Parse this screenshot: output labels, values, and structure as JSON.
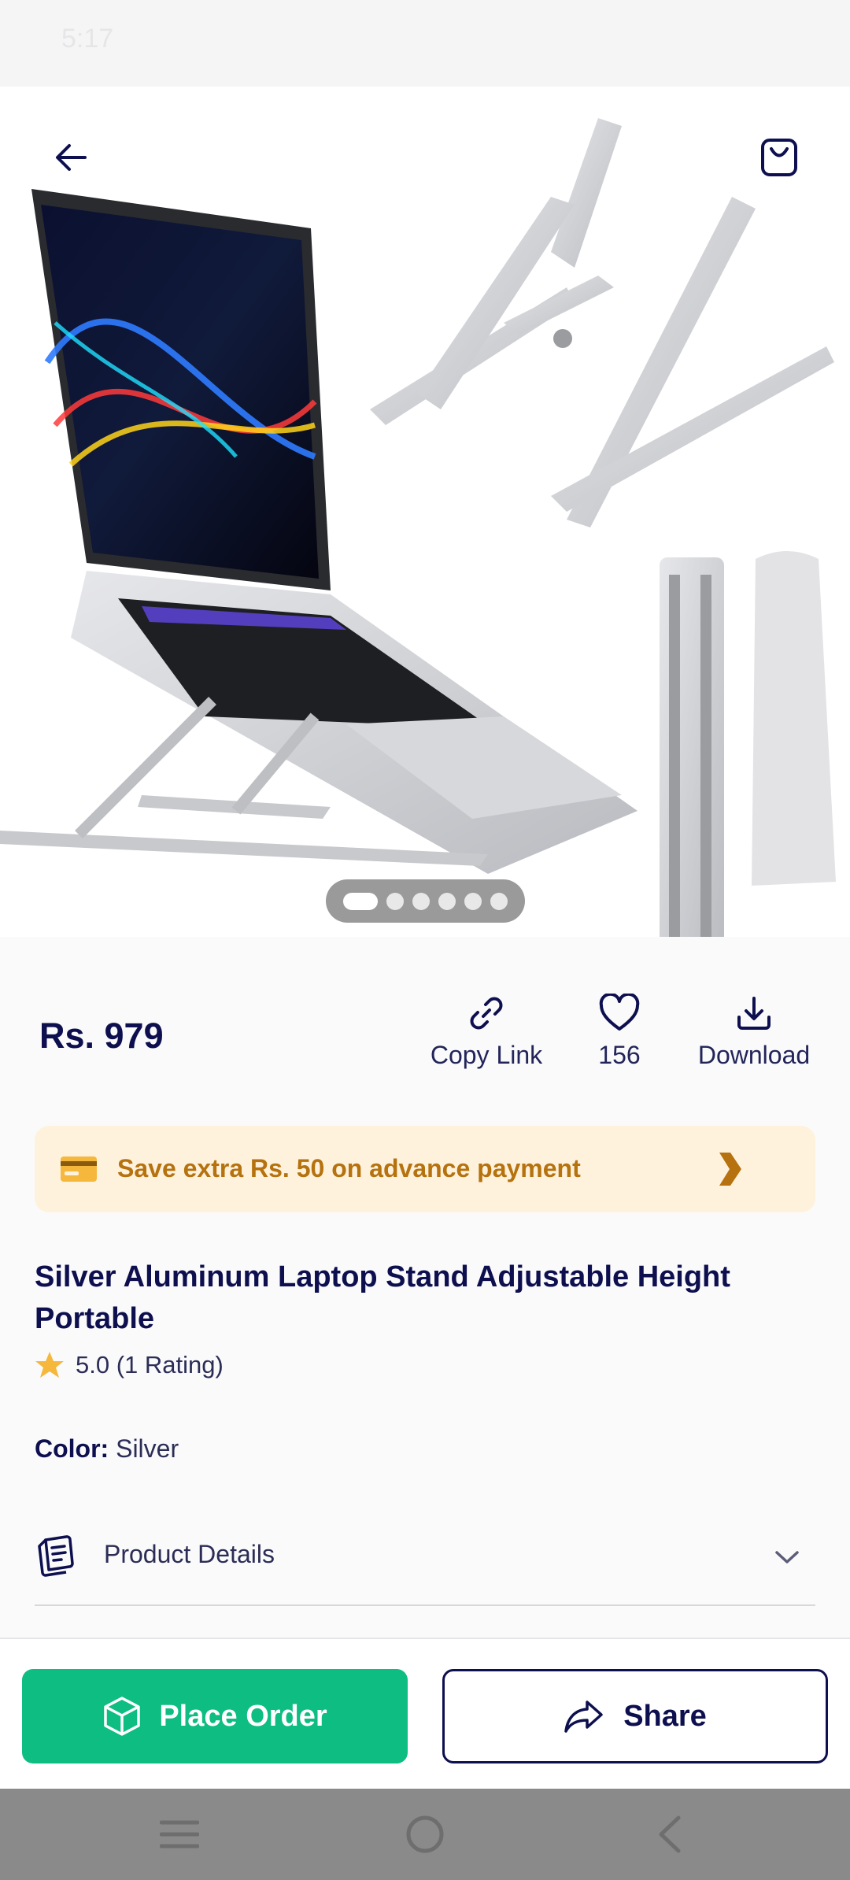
{
  "status_bar": {
    "time": "5:17"
  },
  "gallery": {
    "image_count": 6,
    "active_index": 0
  },
  "product": {
    "price": "Rs. 979",
    "title": "Silver Aluminum Laptop Stand Adjustable Height Portable",
    "rating_text": "5.0 (1 Rating)",
    "rating_value": 5.0,
    "color_label": "Color:",
    "color_value": "Silver"
  },
  "actions": {
    "copy_link": "Copy Link",
    "likes": "156",
    "download": "Download"
  },
  "promo": {
    "text": "Save extra Rs. 50 on advance payment"
  },
  "details": {
    "label": "Product Details"
  },
  "bottom": {
    "place_order": "Place Order",
    "share": "Share"
  },
  "colors": {
    "primary_green": "#0ebd82",
    "navy": "#0d0f4f",
    "promo_bg": "#fff2dd",
    "promo_text": "#b5720e",
    "star": "#f5b73c"
  },
  "icons": [
    "back-arrow-icon",
    "shopping-bag-icon",
    "link-icon",
    "heart-icon",
    "download-icon",
    "card-icon",
    "chevron-right-icon",
    "star-icon",
    "document-icon",
    "chevron-down-icon",
    "box-icon",
    "share-icon",
    "menu-icon",
    "home-icon",
    "back-icon"
  ]
}
